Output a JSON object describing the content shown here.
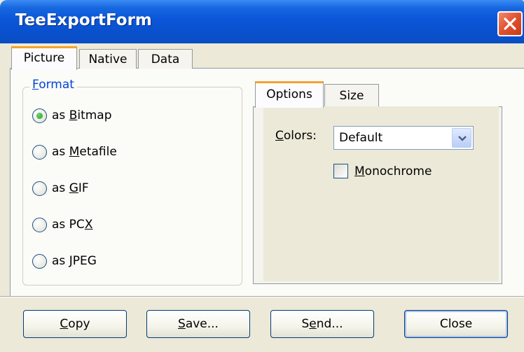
{
  "window": {
    "title": "TeeExportForm"
  },
  "tabs": [
    {
      "label": "Picture"
    },
    {
      "label": "Native"
    },
    {
      "label": "Data"
    }
  ],
  "format": {
    "legend": {
      "mnemonic": "F",
      "rest": "ormat"
    },
    "options": [
      {
        "pre": "as ",
        "mnemonic": "B",
        "post": "itmap",
        "checked": true
      },
      {
        "pre": "as ",
        "mnemonic": "M",
        "post": "etafile",
        "checked": false
      },
      {
        "pre": "as ",
        "mnemonic": "G",
        "post": "IF",
        "checked": false
      },
      {
        "pre": "as PC",
        "mnemonic": "X",
        "post": "",
        "checked": false
      },
      {
        "pre": "as ",
        "mnemonic": "J",
        "post": "PEG",
        "checked": false
      }
    ]
  },
  "inner_tabs": [
    {
      "label": "Options"
    },
    {
      "label": "Size"
    }
  ],
  "options_panel": {
    "colors_label": {
      "mnemonic": "C",
      "rest": "olors:"
    },
    "colors_value": "Default",
    "monochrome": {
      "mnemonic": "M",
      "rest": "onochrome",
      "checked": false
    }
  },
  "buttons": {
    "copy": {
      "mnemonic": "C",
      "rest": "opy"
    },
    "save": {
      "mnemonic": "S",
      "rest": "ave..."
    },
    "send": {
      "pre": "S",
      "mnemonic": "e",
      "rest": "nd..."
    },
    "close": {
      "label": "Close"
    }
  },
  "colors": {
    "title_bar": "#0a56d8",
    "close_button": "#e0502e",
    "active_tab_accent": "#f4a42e"
  }
}
